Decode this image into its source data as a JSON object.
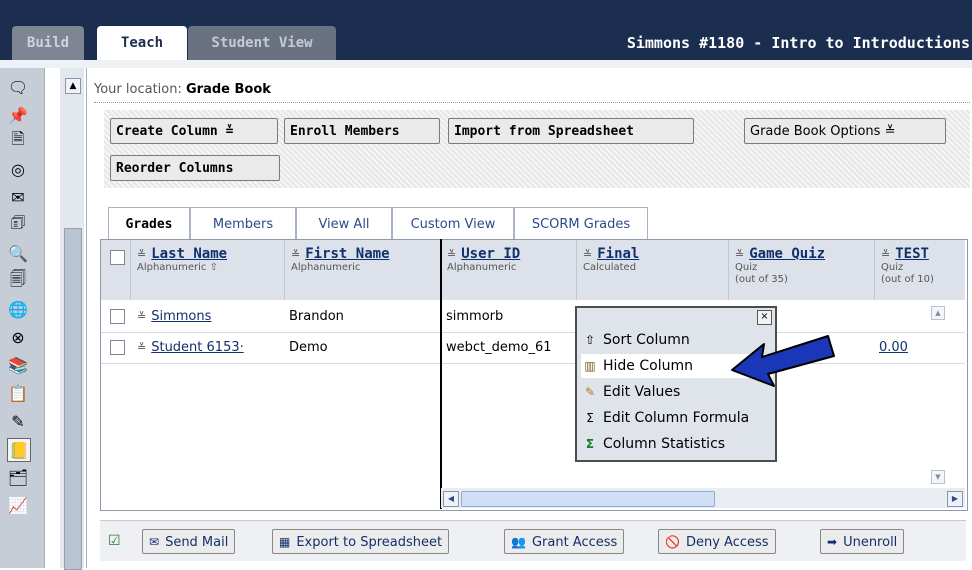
{
  "tabs": {
    "build": "Build",
    "teach": "Teach",
    "student_view": "Student View"
  },
  "course_title": "Simmons #1180 - Intro to Introductions",
  "location": {
    "prefix": "Your location:",
    "current": "Grade Book"
  },
  "toolbar": {
    "create_column": "Create Column",
    "enroll_members": "Enroll Members",
    "import_spreadsheet": "Import from Spreadsheet",
    "gradebook_options": "Grade Book Options",
    "reorder_columns": "Reorder Columns",
    "dropdown_glyph": "≚"
  },
  "view_tabs": [
    "Grades",
    "Members",
    "View All",
    "Custom View",
    "SCORM Grades"
  ],
  "columns": [
    {
      "title": "Last Name",
      "sub": "Alphanumeric ⇧"
    },
    {
      "title": "First Name",
      "sub": "Alphanumeric"
    },
    {
      "title": "User ID",
      "sub": "Alphanumeric"
    },
    {
      "title": "Final",
      "sub": "Calculated"
    },
    {
      "title": "Game Quiz",
      "sub": "Quiz",
      "sub2": "(out of 35)"
    },
    {
      "title": "TEST",
      "sub": "Quiz",
      "sub2": "(out of 10)"
    }
  ],
  "rows": [
    {
      "last_name": "Simmons",
      "first_name": "Brandon",
      "user_id": "simmorb",
      "test": ""
    },
    {
      "last_name": "Student 6153·",
      "first_name": "Demo",
      "user_id": "webct_demo_61",
      "test": "0.00"
    }
  ],
  "context_menu": {
    "items": [
      {
        "label": "Sort Column",
        "icon": "sort-icon"
      },
      {
        "label": "Hide Column",
        "icon": "hide-column-icon",
        "highlighted": true
      },
      {
        "label": "Edit Values",
        "icon": "pencil-icon"
      },
      {
        "label": "Edit Column Formula",
        "icon": "formula-icon"
      },
      {
        "label": "Column Statistics",
        "icon": "sigma-icon"
      }
    ],
    "close_glyph": "×"
  },
  "footer": {
    "send_mail": "Send Mail",
    "export_spreadsheet": "Export to Spreadsheet",
    "grant_access": "Grant Access",
    "deny_access": "Deny Access",
    "unenroll": "Unenroll"
  },
  "colors": {
    "topbar": "#1c2e4f",
    "link": "#10306d",
    "arrow": "#1a37b8"
  }
}
